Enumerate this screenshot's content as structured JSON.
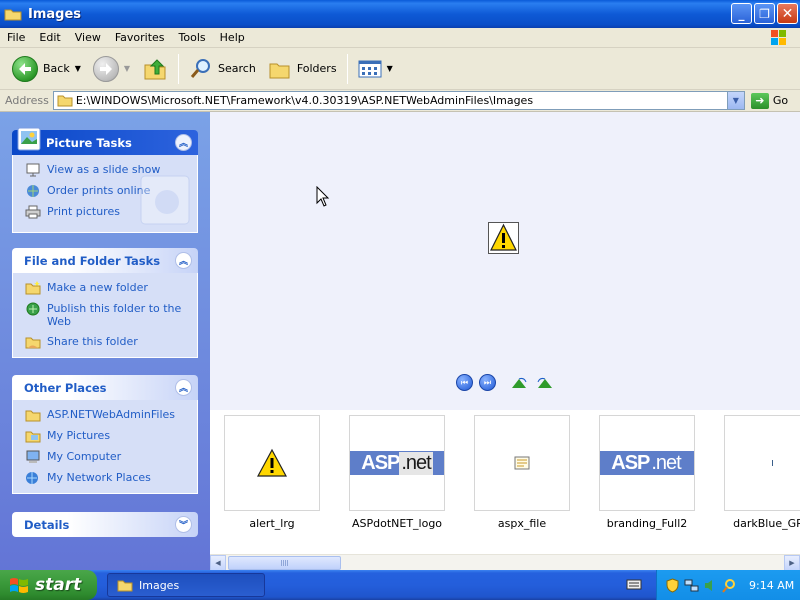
{
  "window": {
    "title": "Images",
    "buttons": {
      "minimize": "_",
      "maximize": "❐",
      "close": "✕"
    }
  },
  "menu": [
    "File",
    "Edit",
    "View",
    "Favorites",
    "Tools",
    "Help"
  ],
  "toolbar": {
    "back_label": "Back",
    "search_label": "Search",
    "folders_label": "Folders"
  },
  "address": {
    "label": "Address",
    "path": "E:\\WINDOWS\\Microsoft.NET\\Framework\\v4.0.30319\\ASP.NETWebAdminFiles\\Images",
    "go_label": "Go"
  },
  "taskpane": {
    "picture_tasks": {
      "title": "Picture Tasks",
      "links": [
        "View as a slide show",
        "Order prints online",
        "Print pictures"
      ]
    },
    "file_folder_tasks": {
      "title": "File and Folder Tasks",
      "links": [
        "Make a new folder",
        "Publish this folder to the Web",
        "Share this folder"
      ]
    },
    "other_places": {
      "title": "Other Places",
      "links": [
        "ASP.NETWebAdminFiles",
        "My Pictures",
        "My Computer",
        "My Network Places"
      ]
    },
    "details": {
      "title": "Details"
    }
  },
  "filmstrip": {
    "items": [
      {
        "label": "alert_lrg",
        "icon": "warning-icon"
      },
      {
        "label": "ASPdotNET_logo",
        "icon": "aspnet-logo"
      },
      {
        "label": "aspx_file",
        "icon": "aspx-file-icon"
      },
      {
        "label": "branding_Full2",
        "icon": "aspnet-branding"
      },
      {
        "label": "darkBlue_GRA",
        "icon": "gradient-image"
      }
    ],
    "asp_text": "ASP",
    "net_text": ".net"
  },
  "taskbar": {
    "start_label": "start",
    "task_label": "Images",
    "clock": "9:14 AM"
  },
  "colors": {
    "titlebar": "#0a5bd8",
    "taskpane_bg": "#7ba2e7",
    "link": "#215dc6",
    "start_green": "#3c9b3c"
  }
}
